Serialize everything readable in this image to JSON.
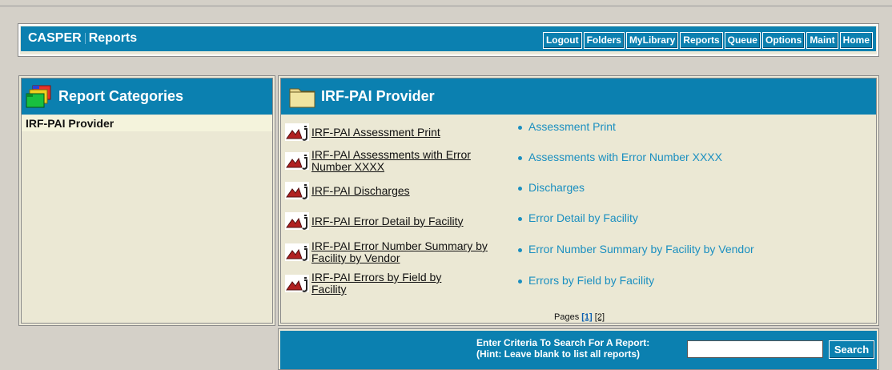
{
  "header": {
    "title_part1": "CASPER",
    "title_part2": "Reports",
    "nav": [
      "Logout",
      "Folders",
      "MyLibrary",
      "Reports",
      "Queue",
      "Options",
      "Maint",
      "Home"
    ]
  },
  "categories": {
    "title": "Report Categories",
    "items": [
      "IRF-PAI Provider"
    ]
  },
  "provider": {
    "title": "IRF-PAI Provider",
    "reports": [
      {
        "link": "IRF-PAI Assessment Print",
        "desc": "Assessment Print"
      },
      {
        "link": "IRF-PAI Assessments with Error Number XXXX",
        "desc": "Assessments with Error Number XXXX"
      },
      {
        "link": "IRF-PAI Discharges",
        "desc": "Discharges"
      },
      {
        "link": "IRF-PAI Error Detail by Facility",
        "desc": "Error Detail by Facility"
      },
      {
        "link": "IRF-PAI Error Number Summary by Facility by Vendor",
        "desc": "Error Number Summary by Facility by Vendor"
      },
      {
        "link": "IRF-PAI Errors by Field by Facility",
        "desc": "Errors by Field by Facility"
      }
    ],
    "pages_label": "Pages",
    "pages": [
      "[1]",
      "[2]"
    ]
  },
  "search": {
    "label_line1": "Enter Criteria To Search For A Report:",
    "label_line2": "(Hint: Leave blank to list all reports)",
    "input_value": "",
    "button": "Search"
  },
  "colors": {
    "header_blue": "#0b80b0",
    "desc_link": "#1a8fc0",
    "panel_bg": "#ebe8d4",
    "frame_bg": "#d4d0c8"
  }
}
